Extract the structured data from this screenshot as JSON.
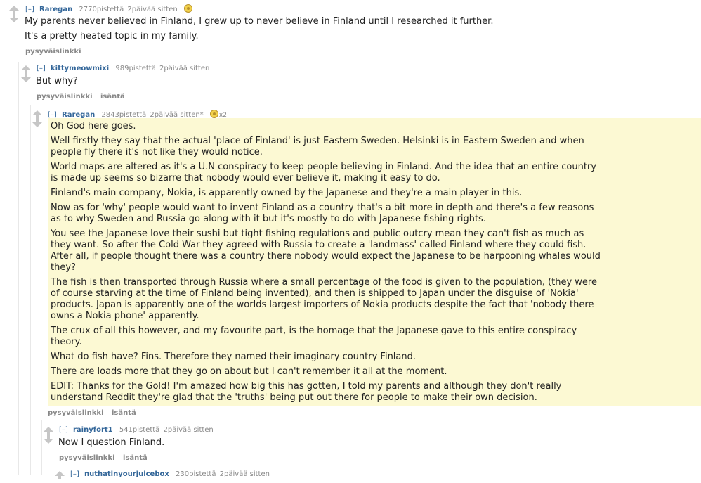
{
  "comments": [
    {
      "expand": "[–]",
      "author": "Raregan",
      "score": "2770pistettä",
      "time": "2päivää sitten",
      "gild_count": "",
      "body": [
        "My parents never believed in Finland, I grew up to never believe in Finland until I researched it further.",
        "It's a pretty heated topic in my family."
      ],
      "buttons": [
        "pysyväislinkki"
      ]
    },
    {
      "expand": "[–]",
      "author": "kittymeowmixi",
      "score": "989pistettä",
      "time": "2päivää sitten",
      "body": [
        "But why?"
      ],
      "buttons": [
        "pysyväislinkki",
        "isäntä"
      ]
    },
    {
      "expand": "[–]",
      "author": "Raregan",
      "score": "2843pistettä",
      "time": "2päivää sitten*",
      "gild_count": "x2",
      "body": [
        "Oh God here goes.",
        "Well firstly they say that the actual 'place of Finland' is just Eastern Sweden. Helsinki is in Eastern Sweden and when people fly there it's not like they would notice.",
        "World maps are altered as it's a U.N conspiracy to keep people believing in Finland. And the idea that an entire country is made up seems so bizarre that nobody would ever believe it, making it easy to do.",
        "Finland's main company, Nokia, is apparently owned by the Japanese and they're a main player in this.",
        "Now as for 'why' people would want to invent Finland as a country that's a bit more in depth and there's a few reasons as to why Sweden and Russia go along with it but it's mostly to do with Japanese fishing rights.",
        "You see the Japanese love their sushi but tight fishing regulations and public outcry mean they can't fish as much as they want. So after the Cold War they agreed with Russia to create a 'landmass' called Finland where they could fish. After all, if people thought there was a country there nobody would expect the Japanese to be harpooning whales would they?",
        "The fish is then transported through Russia where a small percentage of the food is given to the population, (they were of course starving at the time of Finland being invented), and then is shipped to Japan under the disguise of 'Nokia' products. Japan is apparently one of the worlds largest importers of Nokia products despite the fact that 'nobody there owns a Nokia phone' apparently.",
        "The crux of all this however, and my favourite part, is the homage that the Japanese gave to this entire conspiracy theory.",
        "What do fish have? Fins. Therefore they named their imaginary country Finland.",
        "There are loads more that they go on about but I can't remember it all at the moment.",
        "EDIT: Thanks for the Gold! I'm amazed how big this has gotten, I told my parents and although they don't really understand Reddit they're glad that the 'truths' being put out there for people to make their own decision."
      ],
      "buttons": [
        "pysyväislinkki",
        "isäntä"
      ]
    },
    {
      "expand": "[–]",
      "author": "rainyfort1",
      "score": "541pistettä",
      "time": "2päivää sitten",
      "body": [
        "Now I question Finland."
      ],
      "buttons": [
        "pysyväislinkki",
        "isäntä"
      ]
    },
    {
      "expand": "[–]",
      "author": "nuthatinyourjuicebox",
      "score": "230pistettä",
      "time": "2päivää sitten"
    }
  ]
}
